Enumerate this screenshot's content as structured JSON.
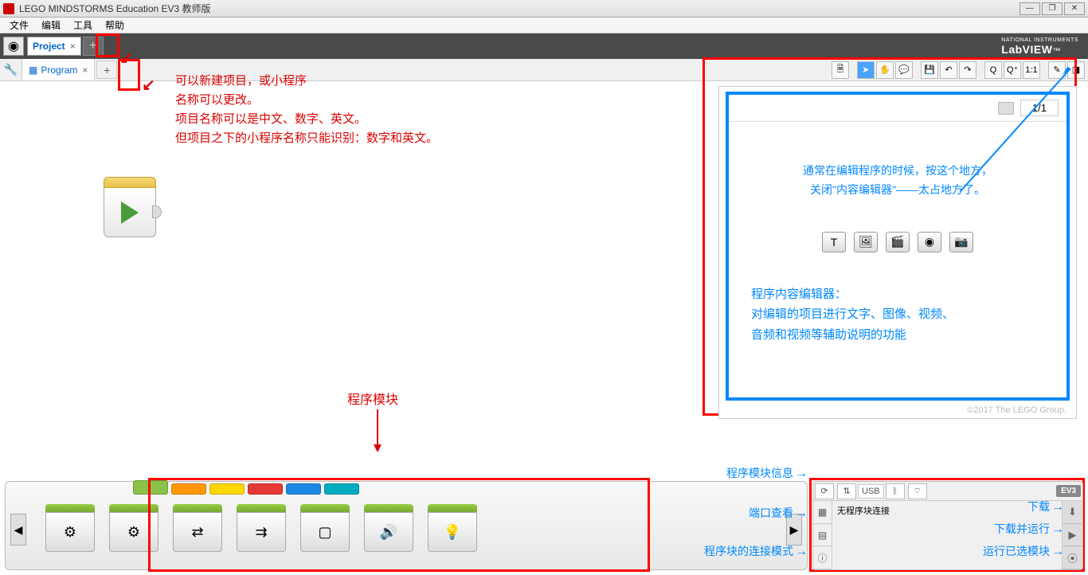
{
  "titlebar": {
    "title": "LEGO MINDSTORMS Education EV3 教师版"
  },
  "menu": {
    "file": "文件",
    "edit": "编辑",
    "tools": "工具",
    "help": "帮助"
  },
  "project_tab": {
    "name": "Project",
    "close": "×"
  },
  "program_tab": {
    "name": "Program",
    "close": "×",
    "icon": "▦"
  },
  "labview": {
    "prefix": "NATIONAL INSTRUMENTS",
    "name": "LabVIEW"
  },
  "toolbar": {
    "ratio": "1:1"
  },
  "content_editor": {
    "page": "1/1",
    "tip1": "通常在编辑程序的时候，按这个地方，",
    "tip2": "关闭\"内容编辑器\"——太占地方了。",
    "title": "程序内容编辑器：",
    "desc1": "对编辑的项目进行文字、图像、视频、",
    "desc2": "音频和视频等辅助说明的功能",
    "copyright": "©2017 The LEGO Group."
  },
  "annotations": {
    "new_project": {
      "l1": "可以新建项目，或小程序",
      "l2": "名称可以更改。",
      "l3": "项目名称可以是中文、数字、英文。",
      "l4": "但项目之下的小程序名称只能识别：数字和英文。"
    },
    "palette_title": "程序模块",
    "palette_info": "程序模块信息",
    "port_view": "端口查看",
    "connect_mode": "程序块的连接模式",
    "download": "下载",
    "download_run": "下载并运行",
    "run_selected": "运行已选模块"
  },
  "brick": {
    "usb": "USB",
    "status": "无程序块连接"
  },
  "colors": {
    "green": "#8bc34a",
    "orange": "#ff9800",
    "yellow": "#ffd600",
    "red": "#e53935",
    "blue": "#1e88e5",
    "teal": "#00acc1"
  }
}
